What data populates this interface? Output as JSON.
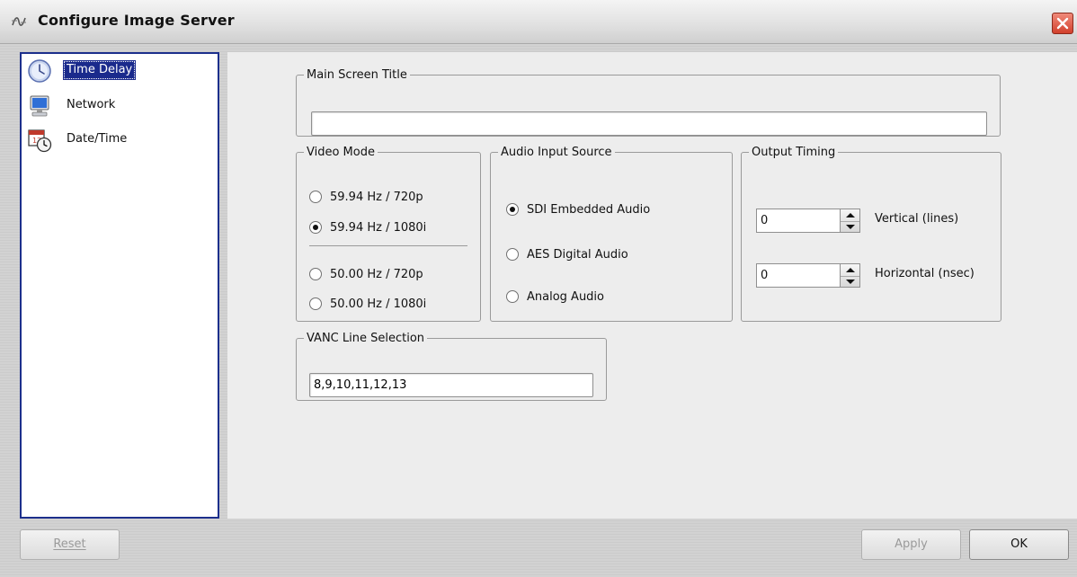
{
  "window": {
    "title": "Configure Image Server",
    "close_icon": "close-icon"
  },
  "nav": {
    "items": [
      {
        "label": "Time Delay",
        "icon": "clock-icon",
        "selected": true
      },
      {
        "label": "Network",
        "icon": "computer-monitor-icon",
        "selected": false
      },
      {
        "label": "Date/Time",
        "icon": "calendar-clock-icon",
        "selected": false
      }
    ]
  },
  "main_screen_title": {
    "legend": "Main Screen Title",
    "value": ""
  },
  "video_mode": {
    "legend": "Video Mode",
    "options": [
      {
        "label": "59.94 Hz / 720p",
        "selected": false
      },
      {
        "label": "59.94 Hz / 1080i",
        "selected": true
      },
      {
        "label": "50.00 Hz / 720p",
        "selected": false
      },
      {
        "label": "50.00 Hz / 1080i",
        "selected": false
      }
    ]
  },
  "audio_input_source": {
    "legend": "Audio Input Source",
    "options": [
      {
        "label": "SDI Embedded Audio",
        "selected": true
      },
      {
        "label": "AES Digital Audio",
        "selected": false
      },
      {
        "label": "Analog Audio",
        "selected": false
      }
    ]
  },
  "output_timing": {
    "legend": "Output Timing",
    "vertical": {
      "value": "0",
      "label": "Vertical (lines)"
    },
    "horizontal": {
      "value": "0",
      "label": "Horizontal (nsec)"
    }
  },
  "vanc_line_selection": {
    "legend": "VANC Line Selection",
    "value": "8,9,10,11,12,13"
  },
  "buttons": {
    "reset": {
      "label": "Reset",
      "enabled": false
    },
    "apply": {
      "label": "Apply",
      "enabled": false
    },
    "ok": {
      "label": "OK",
      "enabled": true
    }
  },
  "colors": {
    "selection": "#1a2a8c",
    "close_button": "#d2402c"
  }
}
